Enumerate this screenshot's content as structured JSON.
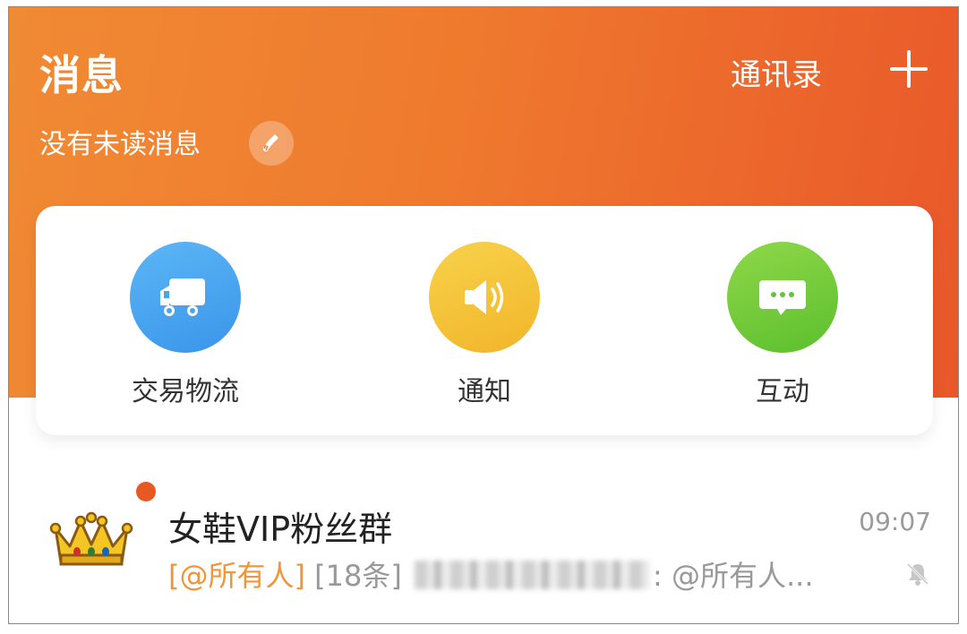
{
  "header": {
    "title": "消息",
    "contacts_label": "通讯录",
    "add_icon": "plus-icon",
    "unread_status": "没有未读消息",
    "clean_icon": "broom-icon",
    "gradient_colors": [
      "#f08a34",
      "#e9582a"
    ]
  },
  "categories": [
    {
      "label": "交易物流",
      "icon": "truck-icon",
      "color": "#3a95ea"
    },
    {
      "label": "通知",
      "icon": "speaker-icon",
      "color": "#f2b52a"
    },
    {
      "label": "互动",
      "icon": "chat-bubble-icon",
      "color": "#5cbf2d"
    }
  ],
  "chats": [
    {
      "name": "女鞋VIP粉丝群",
      "time": "09:07",
      "mention_tag": "[@所有人]",
      "count_tag": "[18条]",
      "preview_tail": ": @所有人...",
      "avatar_icon": "crown-icon",
      "muted_icon": "bell-muted-icon",
      "unread_dot_color": "#e65a22"
    }
  ]
}
